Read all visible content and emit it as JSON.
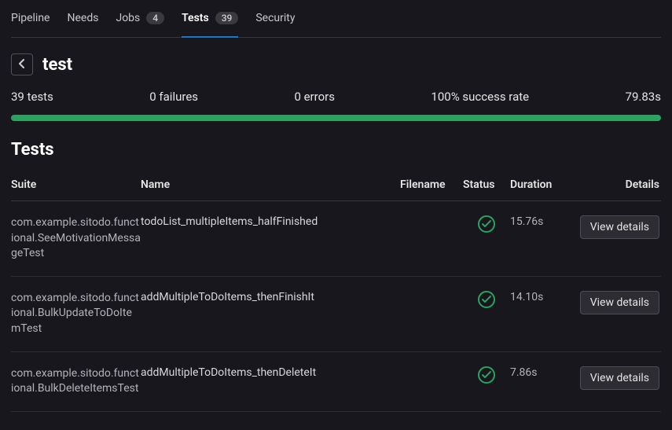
{
  "colors": {
    "accent_tab": "#1f75cb",
    "success": "#2da160"
  },
  "tabs": {
    "pipeline": {
      "label": "Pipeline"
    },
    "needs": {
      "label": "Needs"
    },
    "jobs": {
      "label": "Jobs",
      "count": "4"
    },
    "tests": {
      "label": "Tests",
      "count": "39"
    },
    "security": {
      "label": "Security"
    }
  },
  "heading": {
    "title": "test"
  },
  "summary": {
    "tests": "39 tests",
    "failures": "0 failures",
    "errors": "0 errors",
    "success_rate": "100% success rate",
    "duration": "79.83s",
    "progress_pct": "100%"
  },
  "section_title": "Tests",
  "table": {
    "headers": {
      "suite": "Suite",
      "name": "Name",
      "filename": "Filename",
      "status": "Status",
      "duration": "Duration",
      "details": "Details"
    },
    "view_details_label": "View details",
    "rows": [
      {
        "suite": "com.example.sitodo.functional.SeeMotivationMessageTest",
        "name": "todoList_multipleItems_halfFinished",
        "filename": "",
        "status": "passed",
        "duration": "15.76s"
      },
      {
        "suite": "com.example.sitodo.functional.BulkUpdateToDoItemTest",
        "name": "addMultipleToDoItems_thenFinishIt",
        "filename": "",
        "status": "passed",
        "duration": "14.10s"
      },
      {
        "suite": "com.example.sitodo.functional.BulkDeleteItemsTest",
        "name": "addMultipleToDoItems_thenDeleteIt",
        "filename": "",
        "status": "passed",
        "duration": "7.86s"
      }
    ]
  }
}
